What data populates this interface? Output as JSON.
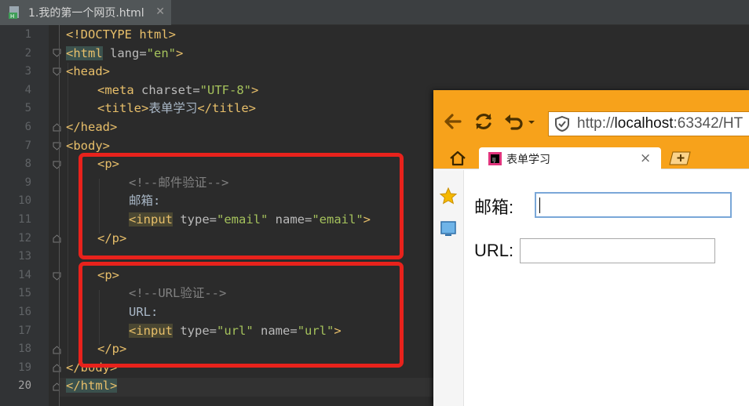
{
  "editor": {
    "tab": {
      "filename": "1.我的第一个网页.html",
      "icon": "html-file-icon"
    },
    "line_numbers": [
      "1",
      "2",
      "3",
      "4",
      "5",
      "6",
      "7",
      "8",
      "9",
      "10",
      "11",
      "12",
      "13",
      "14",
      "15",
      "16",
      "17",
      "18",
      "19",
      "20"
    ],
    "current_line": "20",
    "code": {
      "l1": "<!DOCTYPE html>",
      "l2_open": "<",
      "l2_tag": "html",
      "l2_attr": " lang=",
      "l2_val": "\"en\"",
      "l2_close": ">",
      "l3": "<head>",
      "l4_open": "<meta",
      "l4_attr": " charset=",
      "l4_val": "\"UTF-8\"",
      "l4_close": ">",
      "l5_open": "<title>",
      "l5_text": "表单学习",
      "l5_close": "</title>",
      "l6": "</head>",
      "l7": "<body>",
      "l8": "<p>",
      "l9": "<!--邮件验证-->",
      "l10": "邮箱:",
      "l11_open": "<",
      "l11_tag": "input",
      "l11_attr1": " type=",
      "l11_val1": "\"email\"",
      "l11_attr2": " name=",
      "l11_val2": "\"email\"",
      "l11_close": ">",
      "l12": "</p>",
      "l14": "<p>",
      "l15": "<!--URL验证-->",
      "l16": "URL:",
      "l17_open": "<",
      "l17_tag": "input",
      "l17_attr1": " type=",
      "l17_val1": "\"url\"",
      "l17_attr2": " name=",
      "l17_val2": "\"url\"",
      "l17_close": ">",
      "l18": "</p>",
      "l19": "</body>",
      "l20_open": "</",
      "l20_tag": "html",
      "l20_close": ">"
    },
    "highlight_color": "#e8221c"
  },
  "browser": {
    "address_url_scheme": "http://",
    "address_url_host": "localhost",
    "address_url_rest": ":63342/HT",
    "tab_title": "表单学习",
    "tab_close": "×",
    "toolbar_color": "#f7a21b",
    "page": {
      "email_label": "邮箱:",
      "url_label": "URL:"
    }
  }
}
